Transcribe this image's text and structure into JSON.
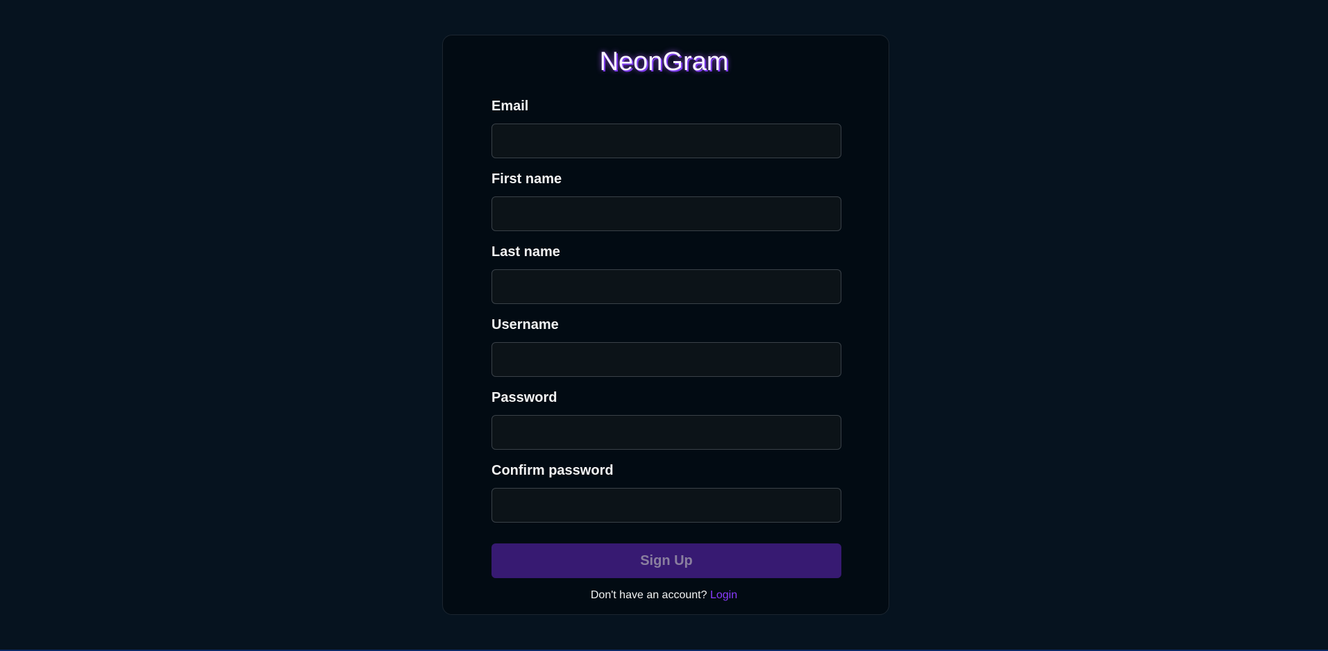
{
  "app": {
    "title": "NeonGram"
  },
  "form": {
    "fields": [
      {
        "label": "Email",
        "value": "",
        "type": "email"
      },
      {
        "label": "First name",
        "value": "",
        "type": "text"
      },
      {
        "label": "Last name",
        "value": "",
        "type": "text"
      },
      {
        "label": "Username",
        "value": "",
        "type": "text"
      },
      {
        "label": "Password",
        "value": "",
        "type": "password"
      },
      {
        "label": "Confirm password",
        "value": "",
        "type": "password"
      }
    ],
    "submit_label": "Sign Up"
  },
  "footer": {
    "prompt": "Don't have an account?",
    "link_label": "Login"
  },
  "colors": {
    "background": "#06131f",
    "card": "#020b13",
    "accent": "#371a72",
    "link": "#8b3cff"
  }
}
